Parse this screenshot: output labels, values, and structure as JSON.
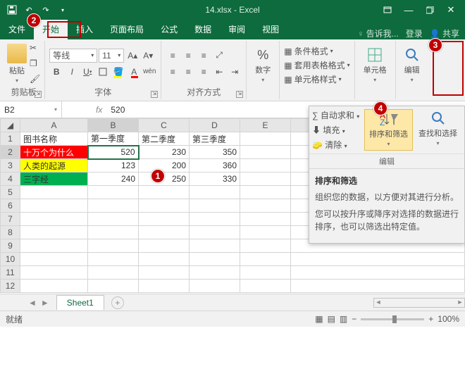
{
  "title": "14.xlsx - Excel",
  "tabs": {
    "file": "文件",
    "home": "开始",
    "insert": "插入",
    "layout": "页面布局",
    "formulas": "公式",
    "data": "数据",
    "review": "审阅",
    "view": "视图",
    "tellme": "告诉我...",
    "login": "登录",
    "share": "共享"
  },
  "groups": {
    "clipboard": "剪贴板",
    "font": "字体",
    "align": "对齐方式",
    "number": "数字",
    "cells": "单元格",
    "edit": "编辑"
  },
  "clipboard": {
    "paste": "粘贴"
  },
  "font": {
    "name": "等线",
    "size": "11",
    "bold": "B",
    "italic": "I",
    "underline": "U"
  },
  "number": {
    "label": "数字"
  },
  "styles": {
    "cond": "条件格式",
    "table": "套用表格格式",
    "cell": "单元格样式"
  },
  "cells": {
    "label": "单元格"
  },
  "editgrp": {
    "label": "编辑"
  },
  "namebox": "B2",
  "fval": "520",
  "cols": [
    "A",
    "B",
    "C",
    "D",
    "E"
  ],
  "headers": {
    "a": "图书名称",
    "b": "第一季度",
    "c": "第二季度",
    "d": "第三季度"
  },
  "rows": [
    {
      "n": "1"
    },
    {
      "n": "2",
      "a": "十万个为什么",
      "b": "520",
      "c": "230",
      "d": "350"
    },
    {
      "n": "3",
      "a": "人类的起源",
      "b": "123",
      "c": "200",
      "d": "360"
    },
    {
      "n": "4",
      "a": "三字经",
      "b": "240",
      "c": "250",
      "d": "330"
    },
    {
      "n": "5"
    },
    {
      "n": "6"
    },
    {
      "n": "7"
    },
    {
      "n": "8"
    },
    {
      "n": "9"
    },
    {
      "n": "10"
    },
    {
      "n": "11"
    },
    {
      "n": "12"
    }
  ],
  "editpop": {
    "sum": "自动求和",
    "fill": "填充",
    "clear": "清除",
    "sort": "排序和筛选",
    "find": "查找和选择",
    "grp": "编辑",
    "tt_title": "排序和筛选",
    "tt_p1": "组织您的数据，以方便对其进行分析。",
    "tt_p2": "您可以按升序或降序对选择的数据进行排序，也可以筛选出特定值。"
  },
  "sheettab": "Sheet1",
  "status": {
    "ready": "就绪",
    "zoom": "100%"
  },
  "callouts": {
    "c1": "1",
    "c2": "2",
    "c3": "3",
    "c4": "4"
  }
}
